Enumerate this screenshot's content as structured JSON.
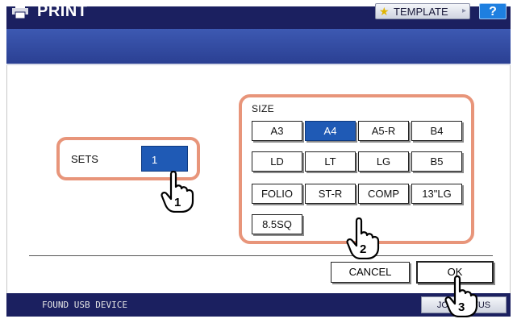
{
  "header": {
    "title": "PRINT",
    "template_label": "TEMPLATE",
    "help_label": "?"
  },
  "sets": {
    "label": "SETS",
    "value": "1"
  },
  "size": {
    "label": "SIZE",
    "selected": "A4",
    "options": [
      "A3",
      "A4",
      "A5-R",
      "B4",
      "LD",
      "LT",
      "LG",
      "B5",
      "FOLIO",
      "ST-R",
      "COMP",
      "13\"LG",
      "8.5SQ"
    ]
  },
  "actions": {
    "cancel_label": "CANCEL",
    "ok_label": "OK"
  },
  "status": {
    "message": "FOUND USB DEVICE",
    "job_status_label": "JOB STATUS"
  },
  "steps": [
    "1",
    "2",
    "3"
  ],
  "colors": {
    "header_bg": "#1b2060",
    "band_bg": "#2f4aa3",
    "selected_bg": "#1f5ab5",
    "callout": "#e8957a",
    "help_bg": "#1e7fe0"
  }
}
